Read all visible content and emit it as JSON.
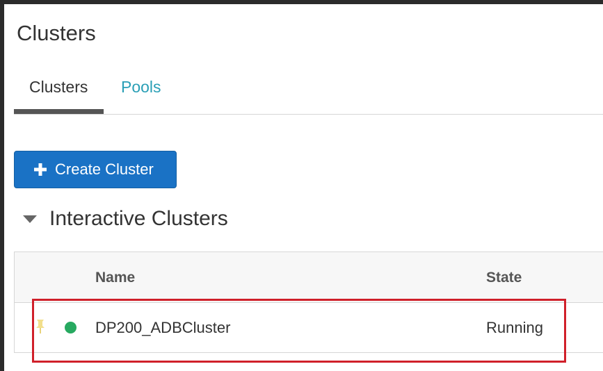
{
  "page": {
    "title": "Clusters"
  },
  "tabs": [
    {
      "label": "Clusters",
      "active": true
    },
    {
      "label": "Pools",
      "active": false
    }
  ],
  "toolbar": {
    "create_label": "Create Cluster",
    "create_icon": "plus-icon"
  },
  "section": {
    "title": "Interactive Clusters",
    "expanded": true
  },
  "table": {
    "columns": [
      "Name",
      "State"
    ],
    "rows": [
      {
        "pinned": true,
        "status_color": "#27a960",
        "name": "DP200_ADBCluster",
        "state": "Running"
      }
    ]
  },
  "colors": {
    "accent": "#1a72c5",
    "link": "#2a9fb6",
    "highlight": "#d0202a",
    "running": "#27a960"
  }
}
